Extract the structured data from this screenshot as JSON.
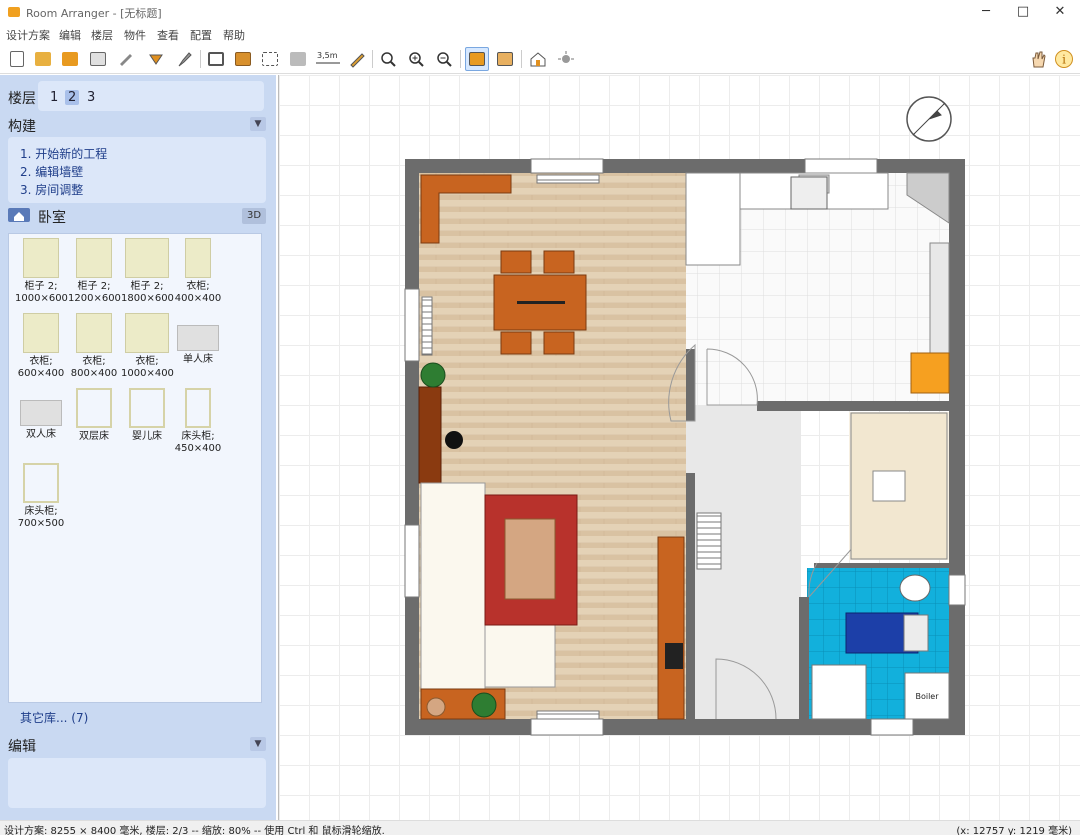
{
  "window": {
    "title": "Room Arranger - [无标题]",
    "minimize_glyph": "─",
    "maximize_glyph": "□",
    "close_glyph": "✕"
  },
  "menu": [
    "设计方案",
    "编辑",
    "楼层",
    "物件",
    "查看",
    "配置",
    "帮助"
  ],
  "toolbar_icons": [
    "new-file-icon",
    "open-folder-icon",
    "save-icon",
    "print-icon",
    "pencil-icon",
    "arrow-icon",
    "brush-icon",
    "room-icon",
    "wall-icon",
    "select-icon",
    "box-icon",
    "measure-icon",
    "draw-icon",
    "zoom-fit-icon",
    "zoom-in-icon",
    "zoom-out-icon",
    "view-2d-icon",
    "view-layers-icon",
    "view-3d-icon",
    "render-icon",
    "hand-icon",
    "info-icon"
  ],
  "toolbar_measure_label": "3,5m",
  "left_panel": {
    "floors_label": "楼层",
    "floors": [
      "1",
      "2",
      "3"
    ],
    "selected_floor": "2",
    "build_label": "构建",
    "build_steps": [
      "1. 开始新的工程",
      "2. 编辑墙壁",
      "3. 房间调整"
    ],
    "category": "卧室",
    "btn_3d": "3D",
    "library_items": [
      {
        "name": "柜子 2;",
        "size": "1000×600"
      },
      {
        "name": "柜子 2;",
        "size": "1200×600"
      },
      {
        "name": "柜子 2;",
        "size": "1800×600"
      },
      {
        "name": "衣柜;",
        "size": "400×400"
      },
      {
        "name": "衣柜;",
        "size": "600×400"
      },
      {
        "name": "衣柜;",
        "size": "800×400"
      },
      {
        "name": "衣柜;",
        "size": "1000×400"
      },
      {
        "name": "单人床",
        "size": ""
      },
      {
        "name": "双人床",
        "size": ""
      },
      {
        "name": "双层床",
        "size": ""
      },
      {
        "name": "婴儿床",
        "size": ""
      },
      {
        "name": "床头柜;",
        "size": "450×400"
      },
      {
        "name": "床头柜;",
        "size": "700×500"
      }
    ],
    "more_libraries": "其它库... (7)",
    "edit_label": "编辑",
    "collapse_glyph": "▼"
  },
  "plan": {
    "boiler_label": "Boiler"
  },
  "status": {
    "left": "设计方案: 8255 × 8400 毫米, 楼层: 2/3 -- 缩放: 80% -- 使用 Ctrl 和 鼠标滑轮缩放.",
    "right": "(x: 12757 y: 1219 毫米)"
  }
}
